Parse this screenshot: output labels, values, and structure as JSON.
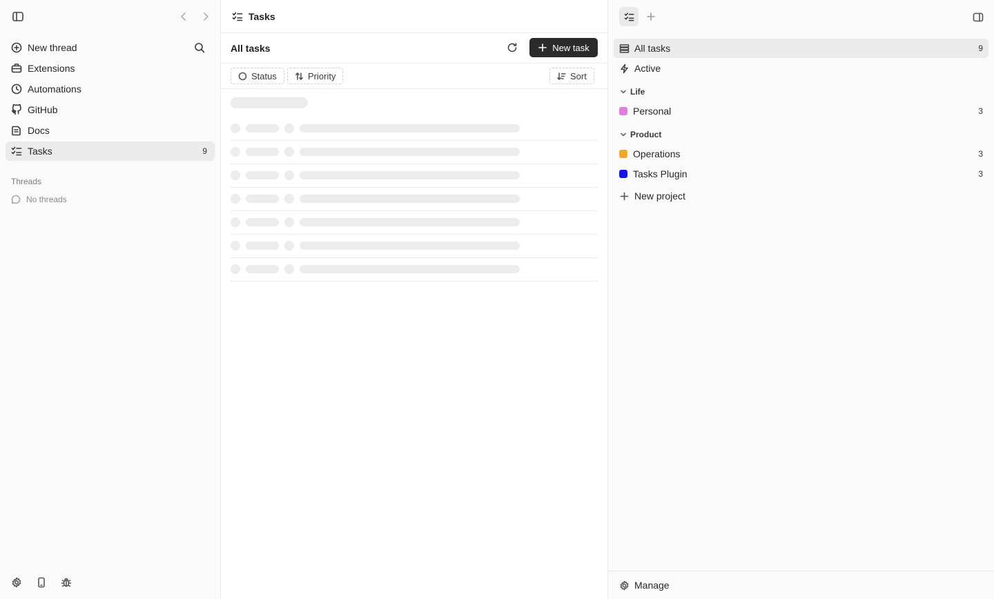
{
  "sidebar": {
    "nav": [
      {
        "label": "New thread",
        "icon": "plus-circle-icon"
      },
      {
        "label": "Extensions",
        "icon": "briefcase-icon"
      },
      {
        "label": "Automations",
        "icon": "clock-icon"
      },
      {
        "label": "GitHub",
        "icon": "github-icon"
      },
      {
        "label": "Docs",
        "icon": "doc-icon"
      },
      {
        "label": "Tasks",
        "icon": "tasks-icon",
        "count": "9"
      }
    ],
    "threads_header": "Threads",
    "no_threads": "No threads"
  },
  "center": {
    "title": "Tasks",
    "list_title": "All tasks",
    "new_task_label": "New task",
    "filters": {
      "status": "Status",
      "priority": "Priority",
      "sort": "Sort"
    }
  },
  "right": {
    "all_tasks": {
      "label": "All tasks",
      "count": "9"
    },
    "active": {
      "label": "Active"
    },
    "groups": [
      {
        "name": "Life",
        "projects": [
          {
            "label": "Personal",
            "count": "3",
            "color": "#e07ee0"
          }
        ]
      },
      {
        "name": "Product",
        "projects": [
          {
            "label": "Operations",
            "count": "3",
            "color": "#f0a830"
          },
          {
            "label": "Tasks Plugin",
            "count": "3",
            "color": "#1414e6"
          }
        ]
      }
    ],
    "new_project": "New project",
    "manage": "Manage"
  }
}
